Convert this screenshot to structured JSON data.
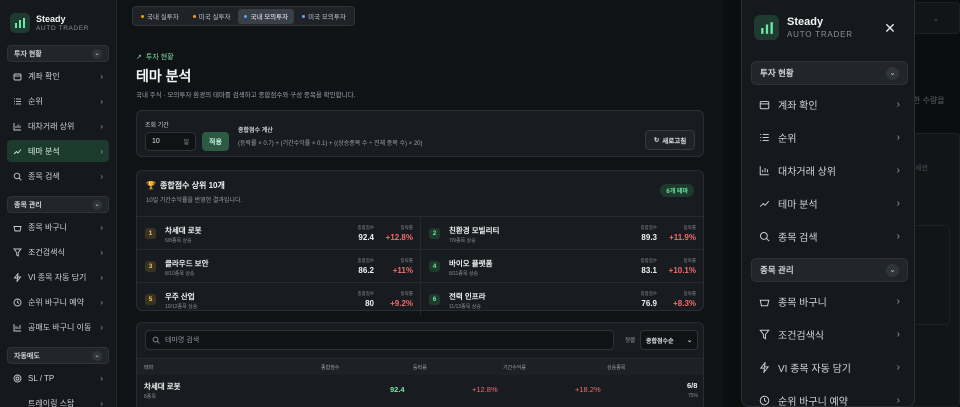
{
  "brand": {
    "name": "Steady",
    "sub": "AUTO TRADER"
  },
  "sidebar": {
    "sections": [
      {
        "label": "투자 현황",
        "items": [
          "계좌 확인",
          "순위",
          "대차거래 상위",
          "테마 분석",
          "종목 검색"
        ]
      },
      {
        "label": "종목 관리",
        "items": [
          "종목 바구니",
          "조건검색식",
          "VI 종목 자동 담기",
          "순위 바구니 예약",
          "공매도 바구니 이동"
        ]
      },
      {
        "label": "자동매도",
        "items": [
          "SL / TP",
          "트레이링 스탑"
        ]
      }
    ],
    "active": "테마 분석"
  },
  "tabs": [
    "국내 실투자",
    "미국 실투자",
    "국내 모의투자",
    "미국 모의투자"
  ],
  "tab_colors": [
    "#f59e0b",
    "#f59e0b",
    "#60a5fa",
    "#60a5fa"
  ],
  "active_tab": "국내 모의투자",
  "page": {
    "crumb": "투자 현황",
    "title": "테마 분석",
    "subtitle": "국내 주식 · 모의투자 환경의 테마를 검색하고 종합점수와 구성 종목을 확인합니다."
  },
  "filter": {
    "period_label": "조회 기간",
    "period_value": "10",
    "period_unit": "일",
    "apply": "적용",
    "formula_title": "종합점수 계산",
    "formula": "(등락률 × 0.7) + (기간수익률 × 0.1) + ((상승종목 수 ÷ 전체 종목 수) × 20)",
    "refresh": "새로고침"
  },
  "top": {
    "title": "종합점수 상위 10개",
    "subtitle": "10일 기간수익률을 반영한 결과입니다.",
    "badge": "6개 테마",
    "score_label": "종합점수",
    "change_label": "등락률",
    "items": [
      {
        "rank": "1",
        "name": "차세대 로봇",
        "sub": "6/8종목 상승",
        "score": "92.4",
        "change": "+12.8%"
      },
      {
        "rank": "2",
        "name": "친환경 모빌리티",
        "sub": "7/9종목 상승",
        "score": "89.3",
        "change": "+11.9%"
      },
      {
        "rank": "3",
        "name": "클라우드 보안",
        "sub": "8/10종목 상승",
        "score": "86.2",
        "change": "+11%"
      },
      {
        "rank": "4",
        "name": "바이오 플랫폼",
        "sub": "8/11종목 상승",
        "score": "83.1",
        "change": "+10.1%"
      },
      {
        "rank": "5",
        "name": "우주 산업",
        "sub": "10/12종목 상승",
        "score": "80",
        "change": "+9.2%"
      },
      {
        "rank": "6",
        "name": "전력 인프라",
        "sub": "11/13종목 상승",
        "score": "76.9",
        "change": "+8.3%"
      }
    ]
  },
  "table": {
    "search_placeholder": "테마명 검색",
    "sort_label": "정렬",
    "sort_value": "종합점수순",
    "headers": [
      "테마",
      "종합점수",
      "등락률",
      "기간수익률",
      "상승종목"
    ],
    "rows": [
      {
        "name": "차세대 로봇",
        "sub": "8종목",
        "score": "92.4",
        "change": "+12.8%",
        "period": "+18.2%",
        "up": "6/8",
        "pct": "75%"
      }
    ]
  },
  "overlay": {
    "bg_text1": "한 수량을",
    "bg_text2": "세션"
  }
}
